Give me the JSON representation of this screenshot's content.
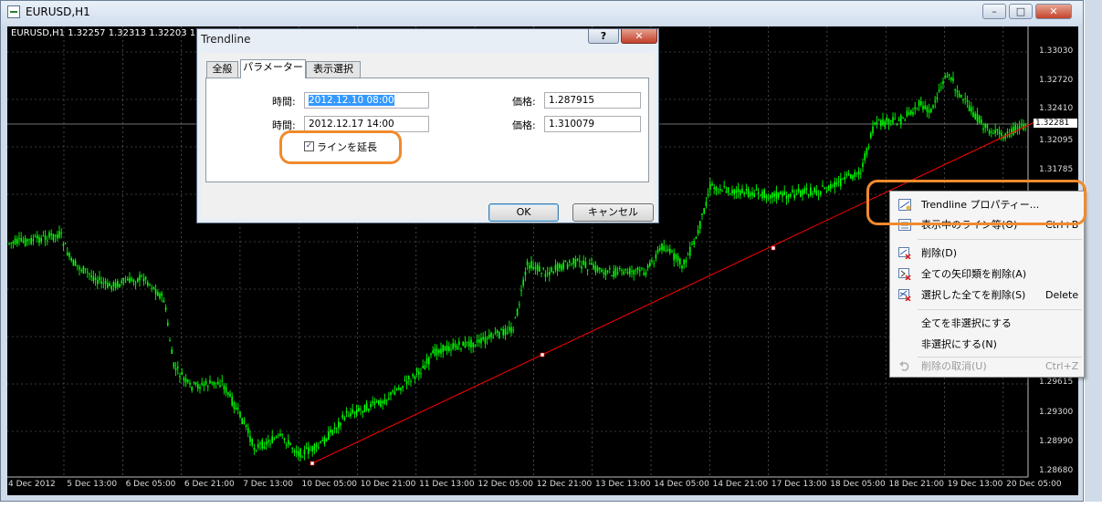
{
  "window": {
    "title": "EURUSD,H1",
    "buttons": {
      "minimize": "–",
      "maximize": "□",
      "close": "✕"
    }
  },
  "chart": {
    "symbol_info": "EURUSD,H1  1.32257 1.32313 1.32203 1.32281",
    "price_ticks": [
      "1.33030",
      "1.32720",
      "1.32410",
      "1.32095",
      "1.31785",
      "1.29615",
      "1.29300",
      "1.28990",
      "1.28680"
    ],
    "current_price": "1.32281",
    "time_ticks": [
      "4 Dec 2012",
      "5 Dec 13:00",
      "6 Dec 05:00",
      "6 Dec 21:00",
      "7 Dec 13:00",
      "10 Dec 05:00",
      "10 Dec 21:00",
      "11 Dec 13:00",
      "12 Dec 05:00",
      "12 Dec 21:00",
      "13 Dec 13:00",
      "14 Dec 05:00",
      "14 Dec 21:00",
      "17 Dec 13:00",
      "18 Dec 05:00",
      "18 Dec 21:00",
      "19 Dec 13:00",
      "20 Dec 05:00"
    ],
    "colors": {
      "background": "#000000",
      "candles": "#00ff00",
      "grid": "#c8c8c8",
      "trendline": "#ff0000"
    }
  },
  "dialog": {
    "title": "Trendline",
    "help": "?",
    "close": "✕",
    "tabs": [
      "全般",
      "パラメーター",
      "表示選択"
    ],
    "active_tab": "パラメーター",
    "time_label": "時間:",
    "price_label": "価格:",
    "time1": "2012.12.10 08:00",
    "time2": "2012.12.17 14:00",
    "price1": "1.287915",
    "price2": "1.310079",
    "extend_label": "ラインを延長",
    "extend_checked": "✓",
    "ok": "OK",
    "cancel": "キャンセル"
  },
  "context_menu": {
    "items": [
      {
        "label": "Trendline プロパティー...",
        "shortcut": "",
        "icon": "trendline-properties-icon",
        "enabled": true
      },
      {
        "label": "表示中のライン等(O)",
        "shortcut": "Ctrl+B",
        "icon": "objects-list-icon",
        "enabled": true
      },
      {
        "label": "削除(D)",
        "shortcut": "",
        "icon": "delete-icon",
        "enabled": true
      },
      {
        "label": "全ての矢印類を削除(A)",
        "shortcut": "",
        "icon": "delete-arrows-icon",
        "enabled": true
      },
      {
        "label": "選択した全てを削除(S)",
        "shortcut": "Delete",
        "icon": "delete-selected-icon",
        "enabled": true
      },
      {
        "label": "全てを非選択にする",
        "shortcut": "",
        "icon": "",
        "enabled": true
      },
      {
        "label": "非選択にする(N)",
        "shortcut": "",
        "icon": "",
        "enabled": true
      },
      {
        "label": "削除の取消(U)",
        "shortcut": "Ctrl+Z",
        "icon": "undo-icon",
        "enabled": false
      }
    ]
  },
  "highlight_color": "#f08a2c"
}
